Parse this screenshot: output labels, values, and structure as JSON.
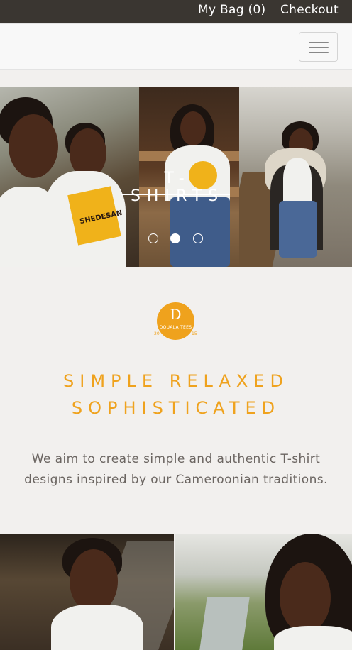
{
  "topbar": {
    "bag_label": "My Bag (0)",
    "checkout_label": "Checkout"
  },
  "navbar": {
    "toggle_icon": "hamburger-menu-icon"
  },
  "carousel": {
    "caption": "T-SHIRTS",
    "indicator_count": 3,
    "active_index": 1,
    "shirt_print": "SHEDESAN"
  },
  "brand": {
    "logo_letter": "D",
    "logo_text": "DOUALA TEES",
    "year_left": "20",
    "year_right": "15"
  },
  "tagline": {
    "line1": "SIMPLE RELAXED",
    "line2": "SOPHISTICATED"
  },
  "description": "We aim to create simple and authentic T-shirt designs inspired by our Cameroonian traditions.",
  "colors": {
    "accent": "#efa21d",
    "topbar": "#3a3631",
    "background": "#f2f0ee"
  }
}
